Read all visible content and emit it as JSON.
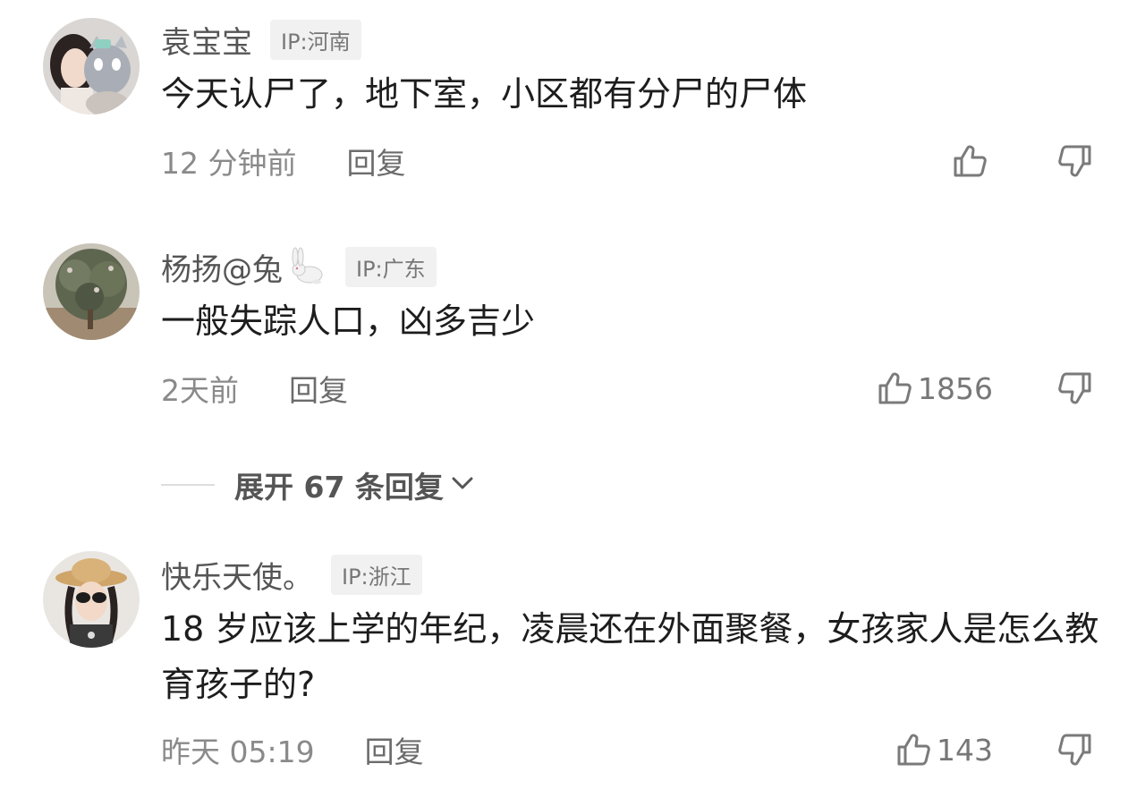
{
  "comments": [
    {
      "username": "袁宝宝",
      "ip": "IP:河南",
      "text": "今天认尸了，地下室，小区都有分尸的尸体",
      "time": "12 分钟前",
      "reply_label": "回复",
      "likes": ""
    },
    {
      "username": "杨扬@兔",
      "ip": "IP:广东",
      "text": "一般失踪人口，凶多吉少",
      "time": "2天前",
      "reply_label": "回复",
      "likes": "1856"
    },
    {
      "username": "快乐天使。",
      "ip": "IP:浙江",
      "text": "18 岁应该上学的年纪，凌晨还在外面聚餐，女孩家人是怎么教育孩子的?",
      "time": "昨天 05:19",
      "reply_label": "回复",
      "likes": "143"
    }
  ],
  "expand_replies": {
    "label": "展开 67 条回复"
  },
  "icons": {
    "like": "thumbs-up-icon",
    "dislike": "thumbs-down-icon",
    "expand": "chevron-down-icon",
    "emoji": "rabbit-emoji-icon"
  },
  "colors": {
    "text_primary": "#1d1d1d",
    "text_secondary": "#8a8a8a",
    "badge_bg": "#f1f1f1"
  }
}
